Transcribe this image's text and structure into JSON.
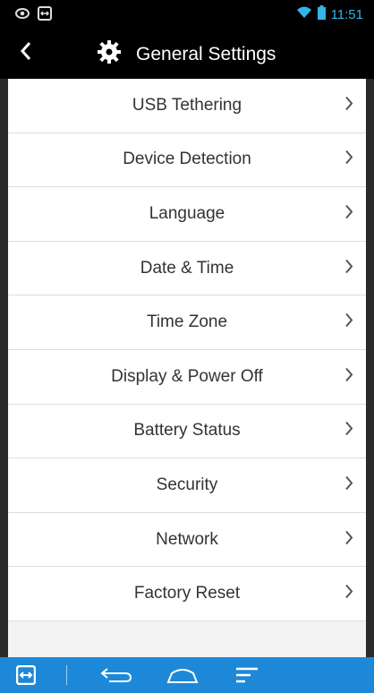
{
  "status_bar": {
    "time": "11:51",
    "icons": [
      "eye-icon",
      "remote-icon",
      "wifi-icon",
      "battery-icon"
    ],
    "accent": "#33b5e5"
  },
  "action_bar": {
    "title": "General Settings",
    "icon": "gear-icon",
    "back_icon": "back-chevron-icon"
  },
  "settings": {
    "items": [
      {
        "label": "USB Tethering"
      },
      {
        "label": "Device Detection"
      },
      {
        "label": "Language"
      },
      {
        "label": "Date & Time"
      },
      {
        "label": "Time Zone"
      },
      {
        "label": "Display & Power Off"
      },
      {
        "label": "Battery Status"
      },
      {
        "label": "Security"
      },
      {
        "label": "Network"
      },
      {
        "label": "Factory Reset"
      }
    ]
  },
  "nav_bar": {
    "color": "#1e88d8",
    "buttons": [
      "remote-icon",
      "back-icon",
      "home-icon",
      "menu-icon"
    ]
  }
}
